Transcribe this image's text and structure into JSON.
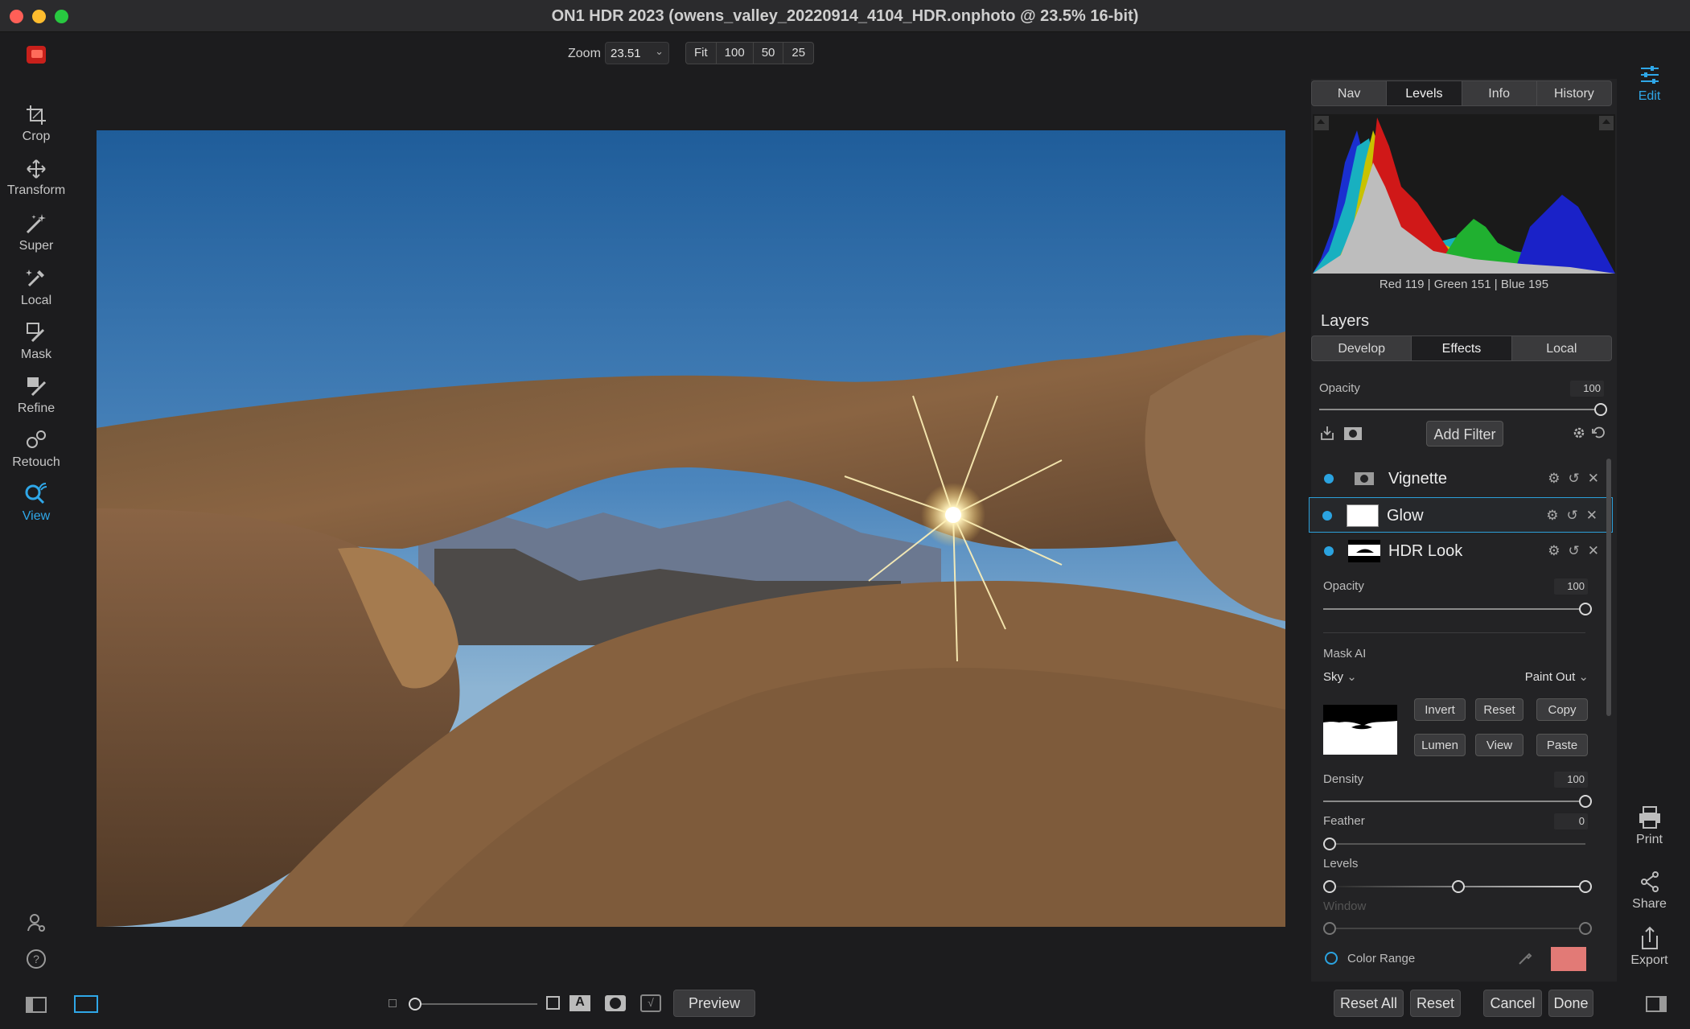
{
  "window": {
    "title": "ON1 HDR 2023 (owens_valley_20220914_4104_HDR.onphoto @ 23.5% 16-bit)",
    "traffic_lights": [
      "#ff5f57",
      "#febc2e",
      "#28c840"
    ]
  },
  "left_toolbar": {
    "tools": [
      {
        "label": "Crop",
        "icon": "crop-icon"
      },
      {
        "label": "Transform",
        "icon": "transform-icon"
      },
      {
        "label": "Super",
        "icon": "super-wand-icon"
      },
      {
        "label": "Local",
        "icon": "local-brush-icon"
      },
      {
        "label": "Mask",
        "icon": "mask-brush-icon"
      },
      {
        "label": "Refine",
        "icon": "refine-brush-icon"
      },
      {
        "label": "Retouch",
        "icon": "retouch-icon"
      },
      {
        "label": "View",
        "icon": "view-zoom-icon",
        "active": true
      }
    ]
  },
  "zoom": {
    "label": "Zoom",
    "value": "23.51",
    "presets": [
      "Fit",
      "100",
      "50",
      "25"
    ]
  },
  "right_icons": {
    "edit": "Edit",
    "print": "Print",
    "share": "Share",
    "export": "Export"
  },
  "panel": {
    "top_tabs": [
      "Nav",
      "Levels",
      "Info",
      "History"
    ],
    "active_top_tab": "Levels",
    "histogram_readout": "Red 119 | Green 151 | Blue 195",
    "layers_title": "Layers",
    "layer_tabs": [
      "Develop",
      "Effects",
      "Local"
    ],
    "active_layer_tab": "Effects",
    "opacity_label": "Opacity",
    "opacity_value": "100",
    "opacity_fraction": 1.0,
    "add_filter": "Add Filter",
    "filters": [
      {
        "name": "Vignette",
        "selected": false
      },
      {
        "name": "Glow",
        "selected": true
      },
      {
        "name": "HDR Look",
        "selected": false
      }
    ],
    "filter_opacity_label": "Opacity",
    "filter_opacity_value": "100",
    "mask_ai_label": "Mask AI",
    "mask_subject": "Sky",
    "mask_mode": "Paint Out",
    "mask_buttons": [
      "Invert",
      "Reset",
      "Copy",
      "Lumen",
      "View",
      "Paste"
    ],
    "density_label": "Density",
    "density_value": "100",
    "feather_label": "Feather",
    "feather_value": "0",
    "levels_label": "Levels",
    "window_label": "Window",
    "color_range_label": "Color Range",
    "color_range_swatch": "#e27a76"
  },
  "bottom": {
    "preview": "Preview",
    "reset_all": "Reset All",
    "reset": "Reset",
    "cancel": "Cancel",
    "done": "Done"
  }
}
